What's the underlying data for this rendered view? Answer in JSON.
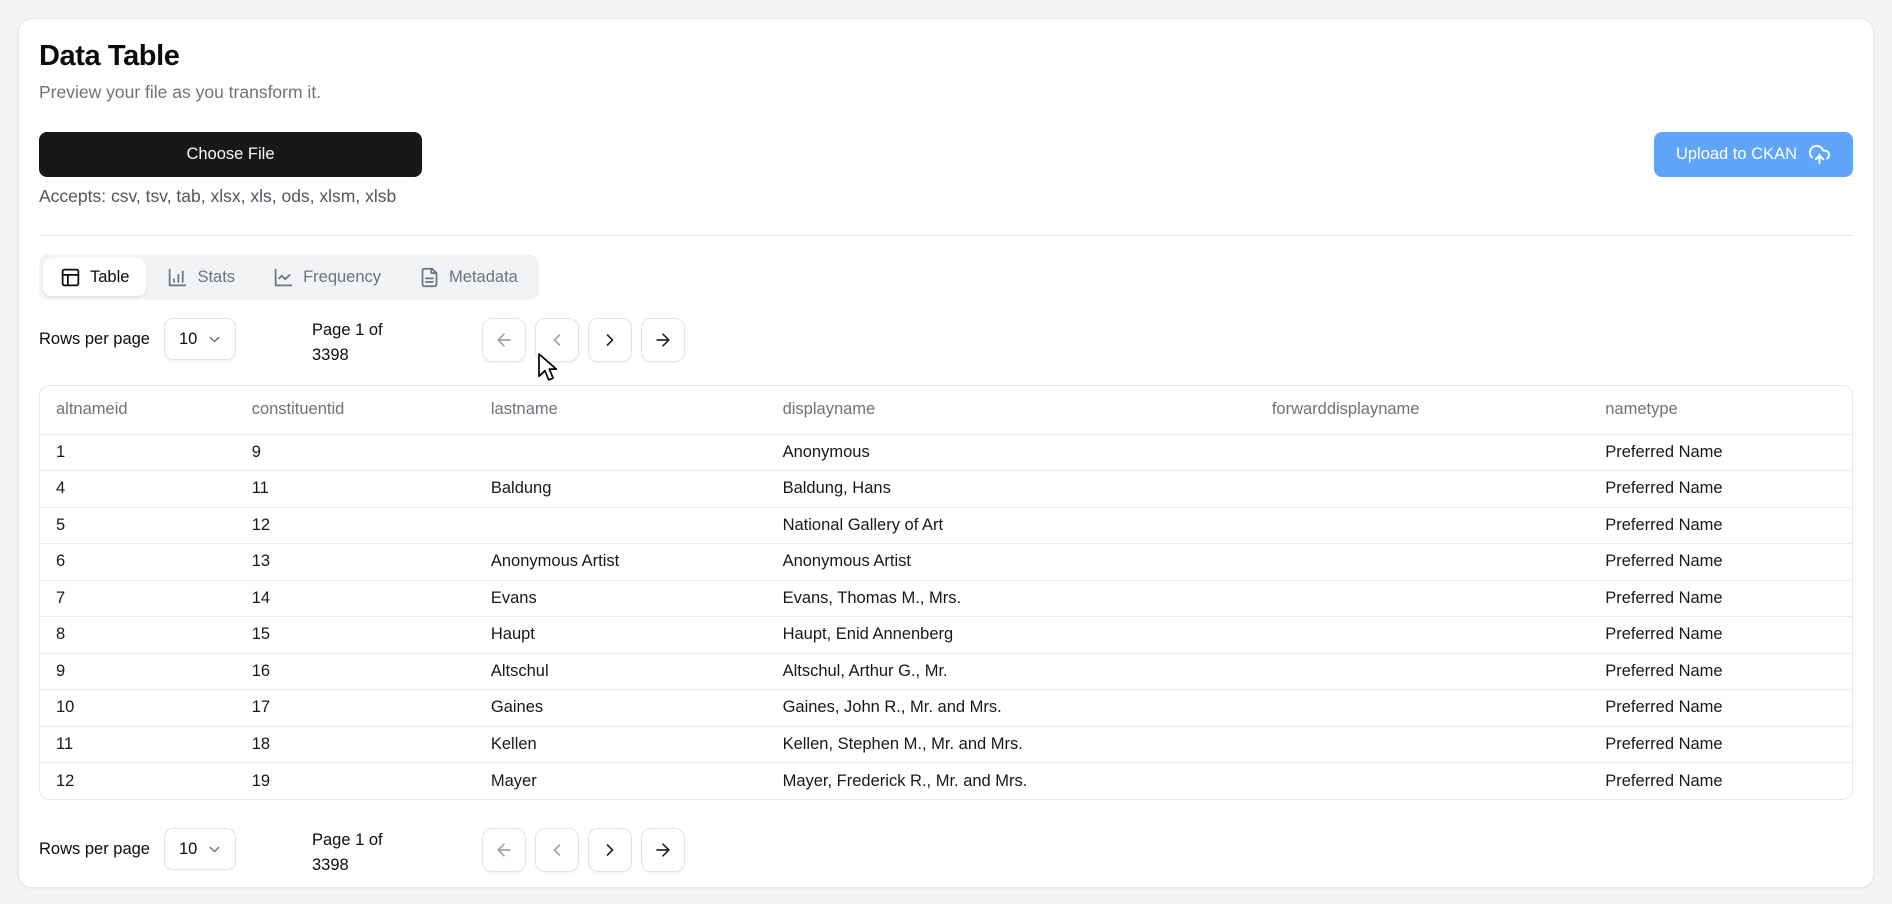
{
  "header": {
    "title": "Data Table",
    "subtitle": "Preview your file as you transform it.",
    "choose_file_label": "Choose File",
    "accepts_text": "Accepts: csv, tsv, tab, xlsx, xls, ods, xlsm, xlsb",
    "upload_label": "Upload to CKAN"
  },
  "tabs": [
    {
      "label": "Table",
      "icon": "table-layout-icon",
      "active": true
    },
    {
      "label": "Stats",
      "icon": "bar-chart-icon",
      "active": false
    },
    {
      "label": "Frequency",
      "icon": "line-chart-icon",
      "active": false
    },
    {
      "label": "Metadata",
      "icon": "file-text-icon",
      "active": false
    }
  ],
  "pagination": {
    "rows_per_page_label": "Rows per page",
    "rows_per_page_value": "10",
    "page_info": "Page 1 of 3398",
    "buttons": [
      {
        "name": "first-page",
        "icon": "arrow-left-icon",
        "disabled": true
      },
      {
        "name": "previous-page",
        "icon": "chevron-left-icon",
        "disabled": true
      },
      {
        "name": "next-page",
        "icon": "chevron-right-icon",
        "disabled": false
      },
      {
        "name": "last-page",
        "icon": "arrow-right-icon",
        "disabled": false
      }
    ]
  },
  "table": {
    "columns": [
      "altnameid",
      "constituentid",
      "lastname",
      "displayname",
      "forwarddisplayname",
      "nametype"
    ],
    "column_widths_pct": [
      10.8,
      13.2,
      16.1,
      27.0,
      18.4,
      14.5
    ],
    "rows": [
      [
        "1",
        "9",
        "",
        "Anonymous",
        "",
        "Preferred Name"
      ],
      [
        "4",
        "11",
        "Baldung",
        "Baldung, Hans",
        "",
        "Preferred Name"
      ],
      [
        "5",
        "12",
        "",
        "National Gallery of Art",
        "",
        "Preferred Name"
      ],
      [
        "6",
        "13",
        "Anonymous Artist",
        "Anonymous Artist",
        "",
        "Preferred Name"
      ],
      [
        "7",
        "14",
        "Evans",
        "Evans, Thomas M., Mrs.",
        "",
        "Preferred Name"
      ],
      [
        "8",
        "15",
        "Haupt",
        "Haupt, Enid Annenberg",
        "",
        "Preferred Name"
      ],
      [
        "9",
        "16",
        "Altschul",
        "Altschul, Arthur G., Mr.",
        "",
        "Preferred Name"
      ],
      [
        "10",
        "17",
        "Gaines",
        "Gaines, John R., Mr. and Mrs.",
        "",
        "Preferred Name"
      ],
      [
        "11",
        "18",
        "Kellen",
        "Kellen, Stephen M., Mr. and Mrs.",
        "",
        "Preferred Name"
      ],
      [
        "12",
        "19",
        "Mayer",
        "Mayer, Frederick R., Mr. and Mrs.",
        "",
        "Preferred Name"
      ]
    ]
  },
  "icons": {
    "upload": "cloud-upload-icon",
    "select": "chevron-down-icon",
    "cursor": "mouse-cursor"
  },
  "colors": {
    "accent_blue": "#60a5fa",
    "dark_button": "#18181b",
    "page_background": "#f4f4f5",
    "muted_text": "#71717a",
    "border": "#e7e7ea"
  }
}
